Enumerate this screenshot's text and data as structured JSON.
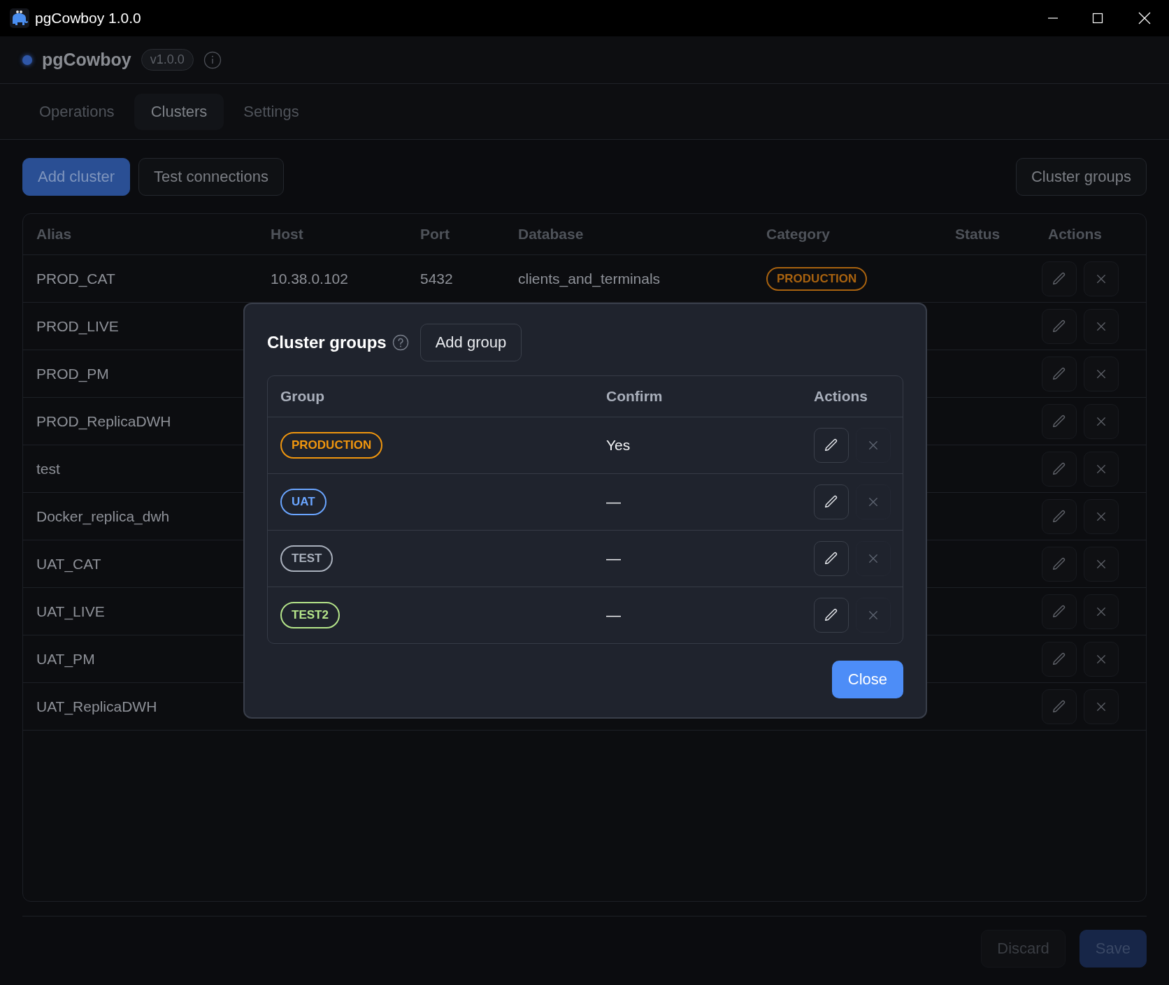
{
  "window": {
    "title": "pgCowboy 1.0.0"
  },
  "app": {
    "name": "pgCowboy",
    "version": "v1.0.0"
  },
  "tabs": [
    {
      "label": "Operations",
      "selected": false
    },
    {
      "label": "Clusters",
      "selected": true
    },
    {
      "label": "Settings",
      "selected": false
    }
  ],
  "toolbar": {
    "add_cluster": "Add cluster",
    "test_connections": "Test connections",
    "cluster_groups": "Cluster groups"
  },
  "table": {
    "columns": [
      "Alias",
      "Host",
      "Port",
      "Database",
      "Category",
      "Status",
      "Actions"
    ],
    "rows": [
      {
        "alias": "PROD_CAT",
        "host": "10.38.0.102",
        "port": "5432",
        "database": "clients_and_terminals",
        "category": {
          "label": "PRODUCTION",
          "color": "#a8620f"
        }
      },
      {
        "alias": "PROD_LIVE"
      },
      {
        "alias": "PROD_PM"
      },
      {
        "alias": "PROD_ReplicaDWH"
      },
      {
        "alias": "test"
      },
      {
        "alias": "Docker_replica_dwh"
      },
      {
        "alias": "UAT_CAT"
      },
      {
        "alias": "UAT_LIVE"
      },
      {
        "alias": "UAT_PM"
      },
      {
        "alias": "UAT_ReplicaDWH"
      }
    ]
  },
  "footer": {
    "buttons": [
      {
        "label": "Discard",
        "kind": "secondary",
        "disabled": true
      },
      {
        "label": "Save",
        "kind": "primary",
        "disabled": true
      }
    ]
  },
  "dialog": {
    "title": "Cluster groups",
    "add_button": "Add group",
    "columns": [
      "Group",
      "Confirm",
      "Actions"
    ],
    "groups": [
      {
        "label": "PRODUCTION",
        "color": "#f0960e",
        "confirm": "Yes",
        "delete_disabled": true
      },
      {
        "label": "UAT",
        "color": "#6aa5ff",
        "confirm": "—",
        "delete_disabled": true
      },
      {
        "label": "TEST",
        "color": "#aab1bd",
        "confirm": "—",
        "delete_disabled": true
      },
      {
        "label": "TEST2",
        "color": "#b5e58a",
        "confirm": "—",
        "delete_disabled": true
      }
    ],
    "close_button": "Close"
  }
}
